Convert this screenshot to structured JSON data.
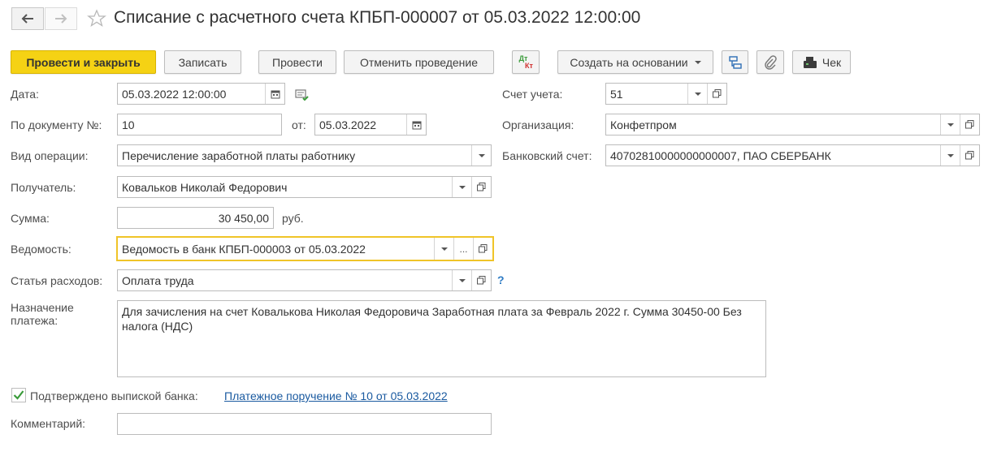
{
  "title": "Списание с расчетного счета КПБП-000007 от 05.03.2022 12:00:00",
  "toolbar": {
    "post_close": "Провести и закрыть",
    "save": "Записать",
    "post": "Провести",
    "unpost": "Отменить проведение",
    "dt_kt_top": "Дт",
    "dt_kt_bottom": "Кт",
    "create_based": "Создать на основании",
    "receipt": "Чек"
  },
  "form": {
    "date_label": "Дата:",
    "date_value": "05.03.2022 12:00:00",
    "doc_num_label": "По документу №:",
    "doc_num_value": "10",
    "from_label": "от:",
    "from_value": "05.03.2022",
    "operation_label": "Вид операции:",
    "operation_value": "Перечисление заработной платы работнику",
    "recipient_label": "Получатель:",
    "recipient_value": "Ковальков Николай Федорович",
    "sum_label": "Сумма:",
    "sum_value": "30 450,00",
    "currency": "руб.",
    "statement_label": "Ведомость:",
    "statement_value": "Ведомость в банк КПБП-000003 от 05.03.2022",
    "expense_label": "Статья расходов:",
    "expense_value": "Оплата труда",
    "purpose_label": "Назначение платежа:",
    "purpose_value": "Для зачисления на счет Ковалькова Николая Федоровича Заработная плата за Февраль 2022 г. Сумма 30450-00 Без налога (НДС)",
    "confirmed_label": "Подтверждено выпиской банка:",
    "confirmed_link": "Платежное поручение № 10 от 05.03.2022",
    "comment_label": "Комментарий:",
    "comment_value": "",
    "account_label": "Счет учета:",
    "account_value": "51",
    "org_label": "Организация:",
    "org_value": "Конфетпром",
    "bank_label": "Банковский счет:",
    "bank_value": "40702810000000000007, ПАО СБЕРБАНК",
    "help": "?",
    "ellipsis": "..."
  },
  "colors": {
    "primary": "#f5d214",
    "focus": "#f0c428",
    "link": "#1a5aa0",
    "check": "#3a9b3a"
  }
}
